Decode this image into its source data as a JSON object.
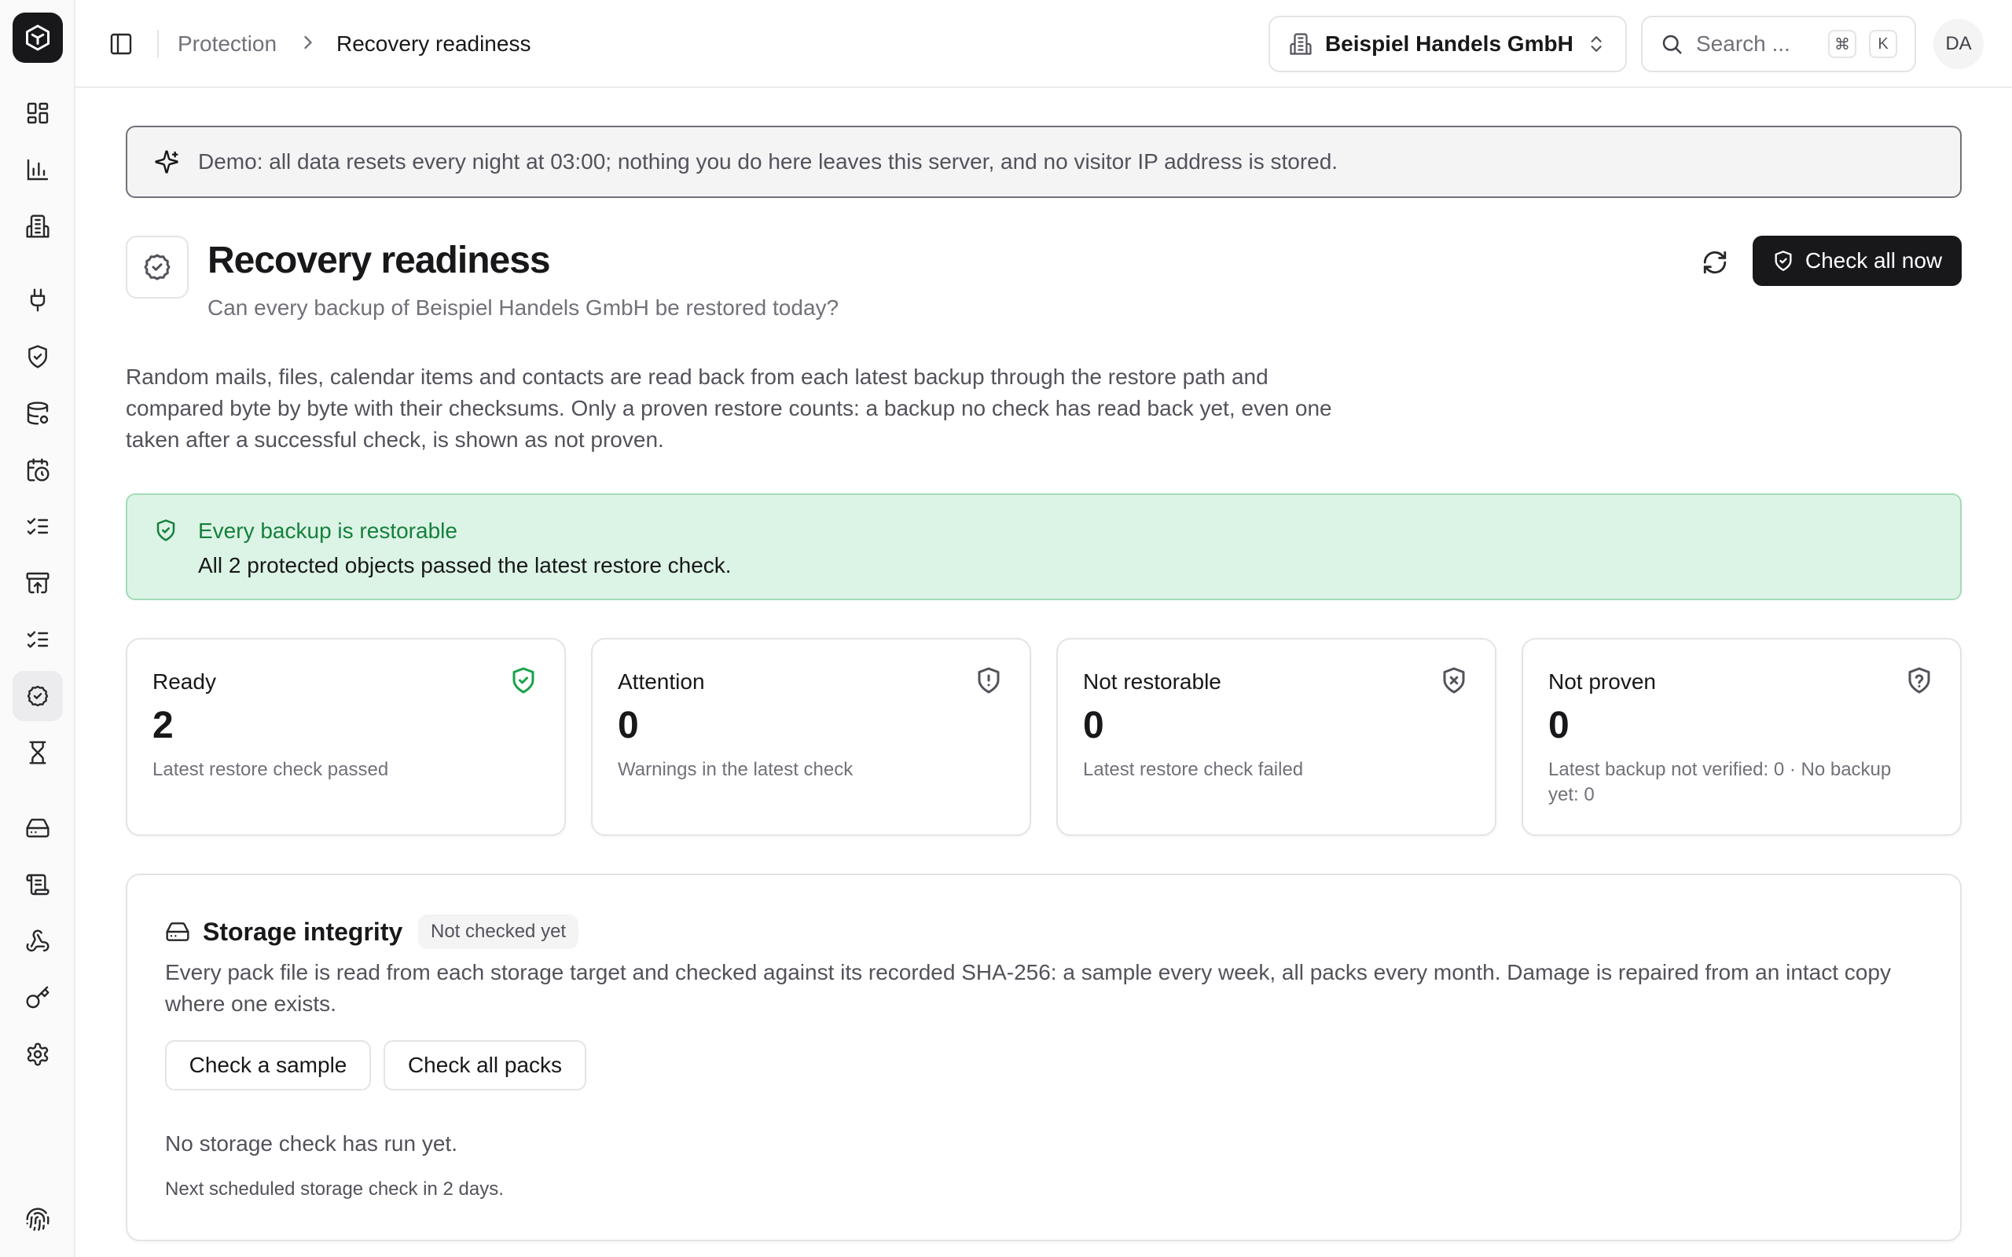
{
  "sidebar": {
    "logo_icon": "hexagon-logo-icon",
    "items": [
      {
        "icon": "dashboard-icon",
        "active": false
      },
      {
        "icon": "bar-chart-icon",
        "active": false
      },
      {
        "icon": "building-icon",
        "active": false
      },
      {
        "icon": "plug-icon",
        "active": false
      },
      {
        "icon": "shield-check-icon",
        "active": false
      },
      {
        "icon": "database-icon",
        "active": false
      },
      {
        "icon": "calendar-clock-icon",
        "active": false
      },
      {
        "icon": "list-checks-icon",
        "active": false
      },
      {
        "icon": "archive-restore-icon",
        "active": false
      },
      {
        "icon": "list-checks-icon",
        "active": false
      },
      {
        "icon": "badge-check-icon",
        "active": true
      },
      {
        "icon": "hourglass-icon",
        "active": false
      },
      {
        "icon": "hard-drive-icon",
        "active": false
      },
      {
        "icon": "scroll-icon",
        "active": false
      },
      {
        "icon": "webhook-icon",
        "active": false
      },
      {
        "icon": "key-icon",
        "active": false
      },
      {
        "icon": "settings-icon",
        "active": false
      },
      {
        "icon": "fingerprint-icon",
        "active": false
      }
    ]
  },
  "topbar": {
    "breadcrumb": [
      "Protection",
      "Recovery readiness"
    ],
    "tenant": "Beispiel Handels GmbH",
    "search_placeholder": "Search ...",
    "shortcut_keys": [
      "⌘",
      "K"
    ],
    "avatar_initials": "DA"
  },
  "banner": {
    "text": "Demo: all data resets every night at 03:00; nothing you do here leaves this server, and no visitor IP address is stored."
  },
  "header": {
    "title": "Recovery readiness",
    "subtitle": "Can every backup of Beispiel Handels GmbH be restored today?",
    "primary_button": "Check all now"
  },
  "description": "Random mails, files, calendar items and contacts are read back from each latest backup through the restore path and compared byte by byte with their checksums. Only a proven restore counts: a backup no check has read back yet, even one taken after a successful check, is shown as not proven.",
  "status": {
    "title": "Every backup is restorable",
    "body": "All 2 protected objects passed the latest restore check."
  },
  "stats": [
    {
      "label": "Ready",
      "value": "2",
      "sub": "Latest restore check passed",
      "icon": "shield-check-icon",
      "color": "#16a34a"
    },
    {
      "label": "Attention",
      "value": "0",
      "sub": "Warnings in the latest check",
      "icon": "shield-alert-icon",
      "color": "#52525b"
    },
    {
      "label": "Not restorable",
      "value": "0",
      "sub": "Latest restore check failed",
      "icon": "shield-x-icon",
      "color": "#52525b"
    },
    {
      "label": "Not proven",
      "value": "0",
      "sub": "Latest backup not verified: 0 · No backup yet: 0",
      "icon": "shield-question-icon",
      "color": "#52525b"
    }
  ],
  "storage": {
    "title": "Storage integrity",
    "badge": "Not checked yet",
    "text": "Every pack file is read from each storage target and checked against its recorded SHA-256: a sample every week, all packs every month. Damage is repaired from an intact copy where one exists.",
    "button_sample": "Check a sample",
    "button_all": "Check all packs",
    "status": "No storage check has run yet.",
    "next": "Next scheduled storage check in 2 days."
  },
  "colors": {
    "accent_dark": "#18181b",
    "success_bg": "#dcf4e5",
    "success_text": "#15803d"
  }
}
